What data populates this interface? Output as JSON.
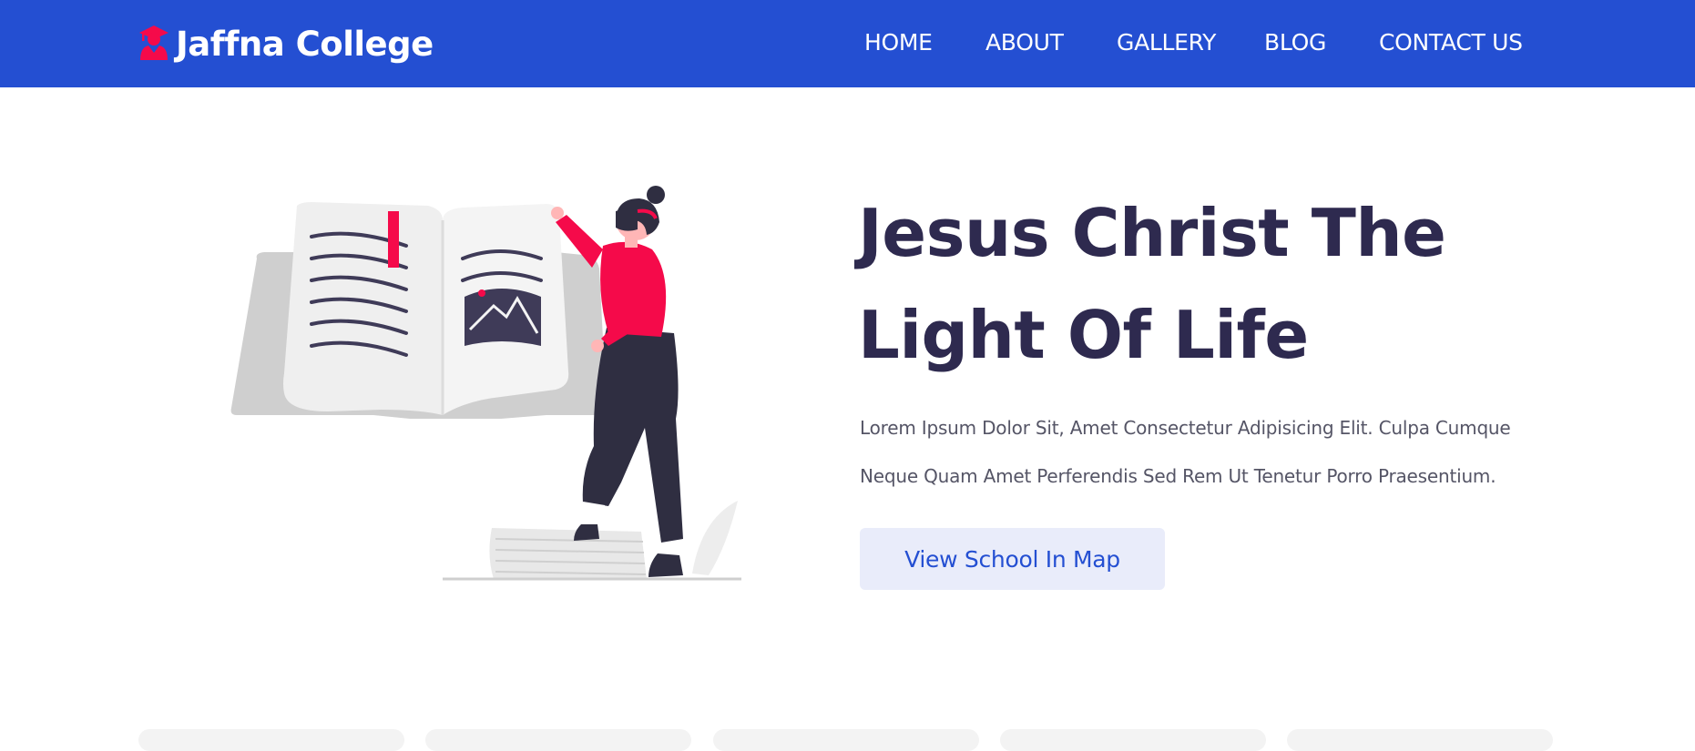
{
  "brand": {
    "name": "Jaffna College",
    "icon": "student-graduation-cap-icon"
  },
  "nav": {
    "items": [
      {
        "label": "HOME"
      },
      {
        "label": "ABOUT"
      },
      {
        "label": "GALLERY"
      },
      {
        "label": "BLOG"
      },
      {
        "label": "CONTACT US"
      }
    ]
  },
  "hero": {
    "title_line1": "Jesus Christ The",
    "title_line2": "Light Of Life",
    "text_line1": "Lorem Ipsum Dolor Sit, Amet Consectetur Adipisicing Elit. Culpa Cumque",
    "text_line2": "Neque Quam Amet Perferendis Sed Rem Ut Tenetur Porro Praesentium.",
    "button_label": "View School In Map",
    "illustration": "woman-reading-book-illustration"
  },
  "colors": {
    "nav_background": "#244fd2",
    "accent_pink": "#f50a4a",
    "title_dark": "#2e2a4f",
    "button_background": "#e9ecfa"
  }
}
